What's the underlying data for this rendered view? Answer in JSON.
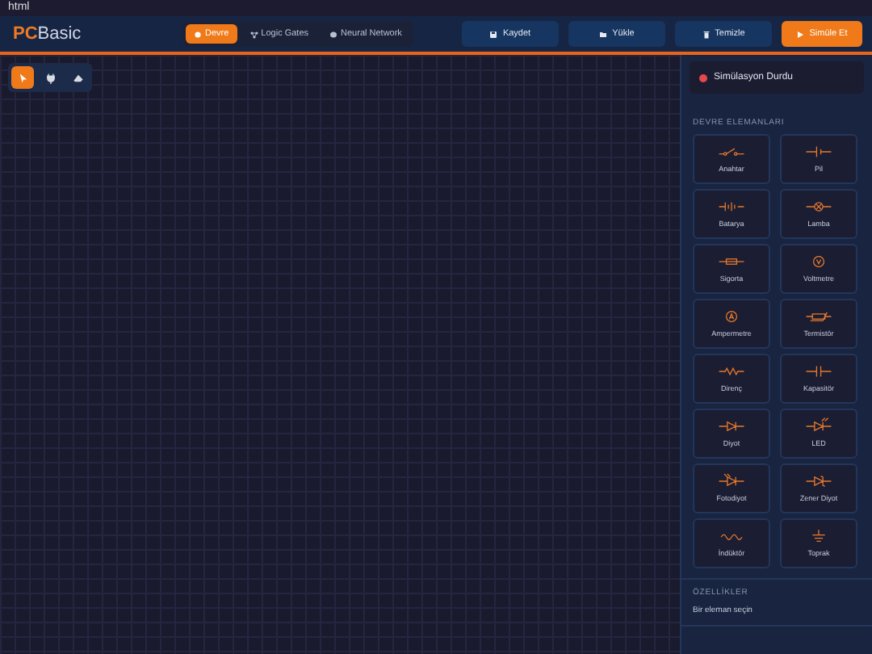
{
  "page_label": "html",
  "header": {
    "logo_accent": "PC",
    "logo_rest": "Basic",
    "tabs": [
      {
        "label": "Devre",
        "selected": true
      },
      {
        "label": "Logic Gates",
        "selected": false
      },
      {
        "label": "Neural Network",
        "selected": false
      }
    ],
    "buttons": [
      {
        "label": "Kaydet",
        "kind": "secondary"
      },
      {
        "label": "Yükle",
        "kind": "secondary"
      },
      {
        "label": "Temizle",
        "kind": "secondary"
      },
      {
        "label": "Simüle Et",
        "kind": "primary"
      }
    ]
  },
  "toolbar": [
    {
      "selected": true
    },
    {
      "selected": false
    },
    {
      "selected": false
    }
  ],
  "sidebar": {
    "status": {
      "text": "Simülasyon Durdu",
      "color": "#e5484d"
    },
    "components_title": "DEVRE ELEMANLARI",
    "components": [
      {
        "label": "Anahtar",
        "kind": "switch"
      },
      {
        "label": "Pil",
        "kind": "cell"
      },
      {
        "label": "Batarya",
        "kind": "battery"
      },
      {
        "label": "Lamba",
        "kind": "lamp"
      },
      {
        "label": "Sigorta",
        "kind": "fuse"
      },
      {
        "label": "Voltmetre",
        "kind": "voltmeter"
      },
      {
        "label": "Ampermetre",
        "kind": "ammeter"
      },
      {
        "label": "Termistör",
        "kind": "thermistor"
      },
      {
        "label": "Direnç",
        "kind": "resistor"
      },
      {
        "label": "Kapasitör",
        "kind": "capacitor"
      },
      {
        "label": "Diyot",
        "kind": "diode"
      },
      {
        "label": "LED",
        "kind": "led"
      },
      {
        "label": "Fotodiyot",
        "kind": "photodiode"
      },
      {
        "label": "Zener Diyot",
        "kind": "zener"
      },
      {
        "label": "İndüktör",
        "kind": "inductor"
      },
      {
        "label": "Toprak",
        "kind": "ground"
      }
    ],
    "properties_title": "ÖZELLİKLER",
    "properties_hint": "Bir eleman seçin"
  }
}
